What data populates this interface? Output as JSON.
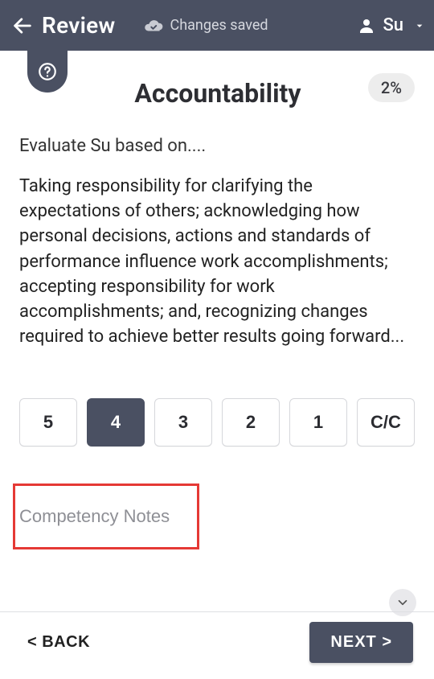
{
  "appbar": {
    "title": "Review",
    "save_status": "Changes saved"
  },
  "user": {
    "name": "Su"
  },
  "progress": {
    "percent_label": "2%"
  },
  "competency": {
    "title": "Accountability",
    "prompt": "Evaluate Su based on....",
    "description": "Taking responsibility for clarifying the expectations of others; acknowledging how personal decisions, actions and standards of performance influence work accomplishments; accepting responsibility for work accomplishments; and, recognizing changes required to achieve better results going forward..."
  },
  "rating": {
    "options": [
      "5",
      "4",
      "3",
      "2",
      "1",
      "C/C"
    ],
    "selected_index": 1
  },
  "notes": {
    "placeholder": "Competency Notes",
    "value": ""
  },
  "footer": {
    "back_label": "<  BACK",
    "next_label": "NEXT   >"
  }
}
